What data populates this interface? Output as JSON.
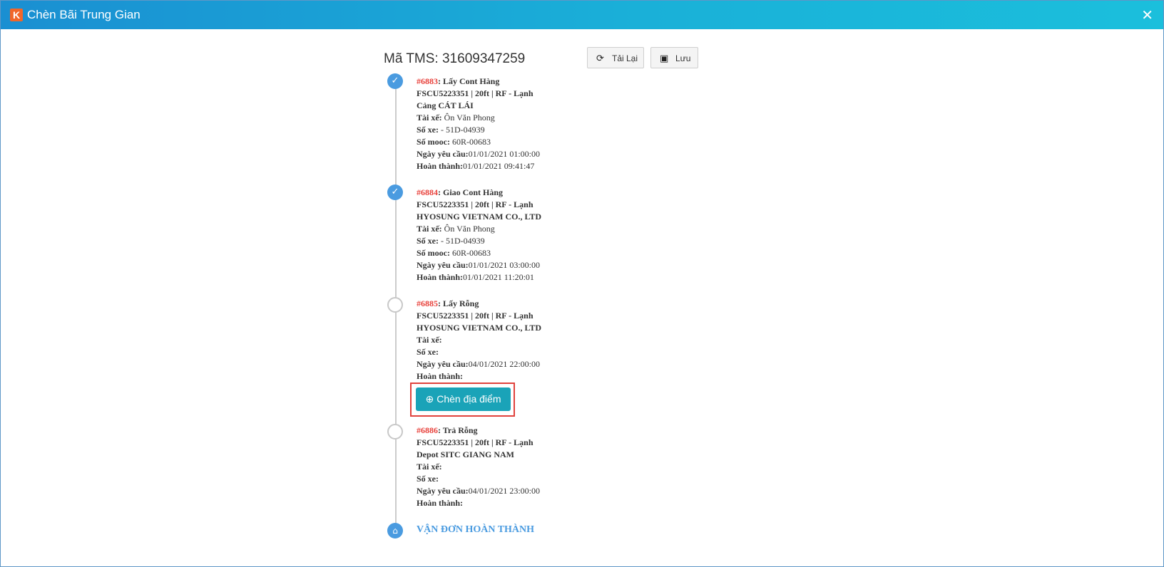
{
  "window": {
    "logo": "K",
    "title": "Chèn Bãi Trung Gian",
    "close": "✕"
  },
  "header": {
    "tms": "Mã TMS: 31609347259",
    "reload_label": "Tải Lại",
    "save_label": "Lưu"
  },
  "steps": [
    {
      "code": "#6883",
      "title": ": Lấy Cont Hàng",
      "container": "FSCU5223351 | 20ft | RF - Lạnh",
      "location": "Cảng CÁT LÁI",
      "driver_label": "Tài xế:",
      "driver": " Ôn Văn Phong",
      "truck_label": "Số xe:",
      "truck": " - 51D-04939",
      "trailer_label": "Số mooc:",
      "trailer": " 60R-00683",
      "request_label": "Ngày yêu cầu:",
      "request": "01/01/2021 01:00:00",
      "done_label": "Hoàn thành:",
      "done": "01/01/2021 09:41:47",
      "status": "done"
    },
    {
      "code": "#6884",
      "title": ": Giao Cont Hàng",
      "container": "FSCU5223351 | 20ft | RF - Lạnh",
      "location": "HYOSUNG VIETNAM CO., LTD",
      "driver_label": "Tài xế:",
      "driver": " Ôn Văn Phong",
      "truck_label": "Số xe:",
      "truck": " - 51D-04939",
      "trailer_label": "Số mooc:",
      "trailer": " 60R-00683",
      "request_label": "Ngày yêu cầu:",
      "request": "01/01/2021 03:00:00",
      "done_label": "Hoàn thành:",
      "done": "01/01/2021 11:20:01",
      "status": "done"
    },
    {
      "code": "#6885",
      "title": ": Lấy Rỗng",
      "container": "FSCU5223351 | 20ft | RF - Lạnh",
      "location": "HYOSUNG VIETNAM CO., LTD",
      "driver_label": "Tài xế:",
      "truck_label": "Số xe:",
      "request_label": "Ngày yêu cầu:",
      "request": "04/01/2021 22:00:00",
      "done_label": "Hoàn thành:",
      "status": "pending"
    },
    {
      "code": "#6886",
      "title": ": Trả Rỗng",
      "container": "FSCU5223351 | 20ft | RF - Lạnh",
      "location": "Depot SITC GIANG NAM",
      "driver_label": "Tài xế:",
      "truck_label": "Số xe:",
      "request_label": "Ngày yêu cầu:",
      "request": "04/01/2021 23:00:00",
      "done_label": "Hoàn thành:",
      "status": "pending"
    }
  ],
  "insert_button": "Chèn địa điểm",
  "final_label": "VẬN ĐƠN HOÀN THÀNH",
  "icons": {
    "check": "check-icon",
    "reload": "refresh-icon",
    "save": "floppy-disk-icon",
    "insert": "plus-circle-icon",
    "final": "home-icon"
  },
  "colors": {
    "titlebar": "#1a8fd2",
    "accent": "#4a9be0",
    "code": "#e8413b",
    "insert_button": "#1aa3b8",
    "highlight_border": "#e0423c"
  }
}
